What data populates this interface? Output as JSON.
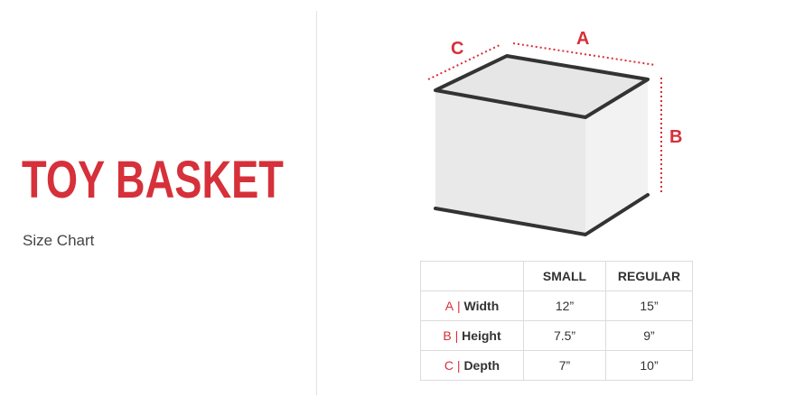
{
  "title": "TOY BASKET",
  "subtitle": "Size Chart",
  "accent_color": "#d6303a",
  "dimension_labels": {
    "a": "A",
    "b": "B",
    "c": "C"
  },
  "table": {
    "headers": [
      "",
      "SMALL",
      "REGULAR"
    ],
    "rows": [
      {
        "letter": "A",
        "sep": "|",
        "name": "Width",
        "small": "12”",
        "regular": "15”"
      },
      {
        "letter": "B",
        "sep": "|",
        "name": "Height",
        "small": "7.5”",
        "regular": "9”"
      },
      {
        "letter": "C",
        "sep": "|",
        "name": "Depth",
        "small": "7”",
        "regular": "10”"
      }
    ]
  }
}
